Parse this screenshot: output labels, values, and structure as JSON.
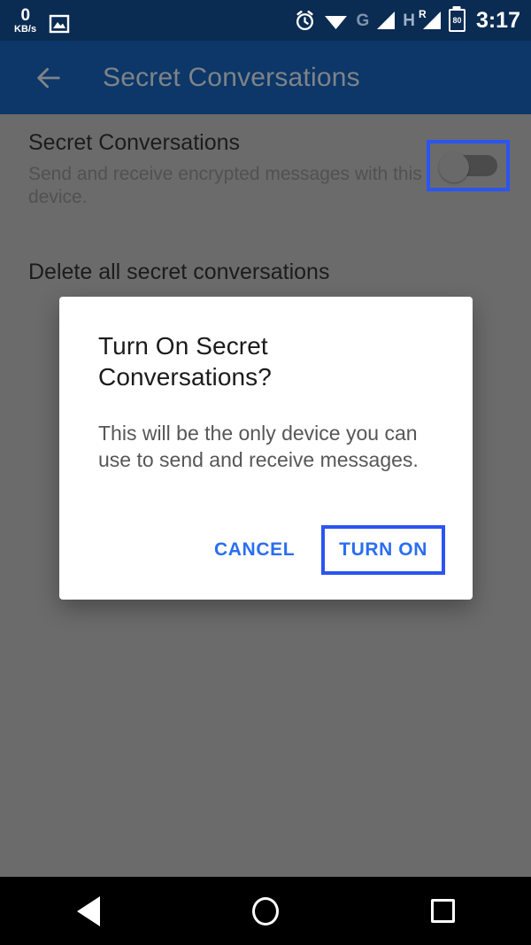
{
  "status_bar": {
    "network_speed_value": "0",
    "network_speed_unit": "KB/s",
    "gallery_icon": "image-icon",
    "alarm_icon": "alarm-clock-icon",
    "wifi_icon": "wifi-icon",
    "network_type_1": "G",
    "signal_icon_1": "signal-bars-icon",
    "network_type_2": "H",
    "roaming_indicator": "R",
    "signal_icon_2": "signal-bars-roaming-icon",
    "battery_level": "80",
    "battery_icon": "battery-icon",
    "time": "3:17",
    "background_color": "#0a2b52"
  },
  "app_bar": {
    "back_icon": "arrow-back-icon",
    "title": "Secret Conversations",
    "background_color": "#0c3768",
    "title_color": "#7f8388"
  },
  "settings": {
    "rows": [
      {
        "title": "Secret Conversations",
        "subtitle": "Send and receive encrypted messages with this device.",
        "toggle_state": "off",
        "toggle_focused": true
      },
      {
        "title": "Delete all secret conversations"
      }
    ]
  },
  "dialog": {
    "title": "Turn On Secret Conversations?",
    "message": "This will be the only device you can use to send and receive messages.",
    "cancel_label": "CANCEL",
    "confirm_label": "TURN ON",
    "confirm_focused": true,
    "accent_color": "#2b6ef0",
    "focus_border_color": "#2b55f0"
  },
  "nav_bar": {
    "back_icon": "nav-back-triangle-icon",
    "home_icon": "nav-home-circle-icon",
    "recents_icon": "nav-recents-square-icon",
    "background_color": "#000000"
  },
  "overlay": {
    "scrim_color": "#6b6b6b"
  }
}
